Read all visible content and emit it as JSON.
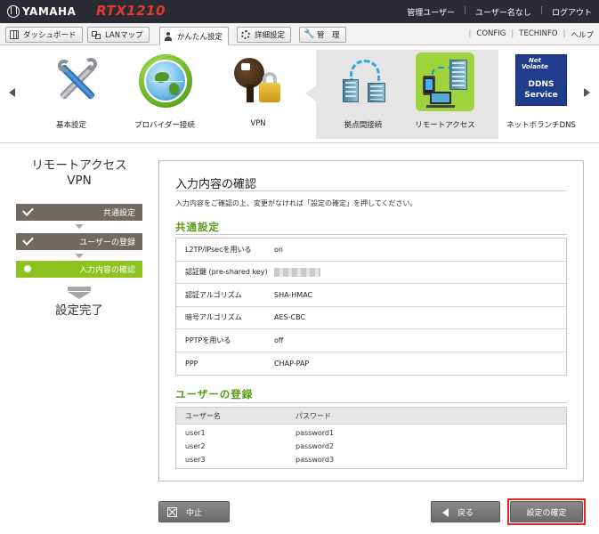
{
  "header": {
    "brand": "YAMAHA",
    "model": "RTX1210",
    "user_label": "管理ユーザー",
    "user_name": "ユーザー名なし",
    "logout": "ログアウト"
  },
  "tabs": [
    {
      "label": "ダッシュボード",
      "icon": "dashboard-icon"
    },
    {
      "label": "LANマップ",
      "icon": "lan-map-icon"
    },
    {
      "label": "かんたん設定",
      "icon": "person-icon"
    },
    {
      "label": "詳細設定",
      "icon": "gear-icon"
    },
    {
      "label": "管　理",
      "icon": "wrench-icon"
    }
  ],
  "toplinks": [
    "CONFIG",
    "TECHINFO",
    "ヘルプ"
  ],
  "wizards": [
    {
      "label": "基本設定",
      "icon": "tools-icon"
    },
    {
      "label": "プロバイダー接続",
      "icon": "globe-icon"
    },
    {
      "label": "VPN",
      "icon": "key-lock-icon"
    },
    {
      "label": "拠点間接続",
      "icon": "site-to-site-icon"
    },
    {
      "label": "リモートアクセス",
      "icon": "remote-access-icon"
    },
    {
      "label": "ネットボランチDNS",
      "icon": "ddns-icon"
    }
  ],
  "ddns_logo": {
    "line1": "Net",
    "line2": "Volante",
    "line3": "DDNS",
    "line4": "Service"
  },
  "sidebar": {
    "title_line1": "リモートアクセス",
    "title_line2": "VPN",
    "steps": [
      {
        "label": "共通設定",
        "state": "done"
      },
      {
        "label": "ユーザーの登録",
        "state": "done"
      },
      {
        "label": "入力内容の確認",
        "state": "current"
      }
    ],
    "final": "設定完了"
  },
  "main": {
    "title": "入力内容の確認",
    "description": "入力内容をご確認の上、変更がなければ「設定の確定」を押してください。",
    "common_title": "共通設定",
    "settings": [
      {
        "key": "L2TP/IPsecを用いる",
        "value": "on"
      },
      {
        "key": "認証鍵 (pre-shared key)",
        "value": ""
      },
      {
        "key": "認証アルゴリズム",
        "value": "SHA-HMAC"
      },
      {
        "key": "暗号アルゴリズム",
        "value": "AES-CBC"
      },
      {
        "key": "PPTPを用いる",
        "value": "off"
      },
      {
        "key": "PPP",
        "value": "CHAP-PAP"
      }
    ],
    "users_title": "ユーザーの登録",
    "users_headers": [
      "ユーザー名",
      "パスワード"
    ],
    "users": [
      {
        "name": "user1",
        "password": "password1"
      },
      {
        "name": "user2",
        "password": "password2"
      },
      {
        "name": "user3",
        "password": "password3"
      }
    ]
  },
  "buttons": {
    "cancel": "中止",
    "back": "戻る",
    "confirm": "設定の確定"
  },
  "colors": {
    "accent_green": "#8dc21f",
    "section_green": "#5c9a16",
    "highlight_red": "#e32222",
    "topbar": "#2b2b33",
    "model_red": "#e23a2f"
  }
}
